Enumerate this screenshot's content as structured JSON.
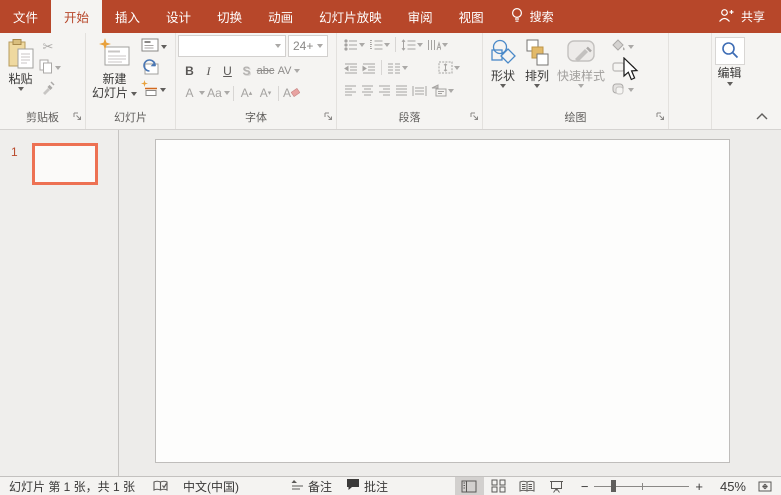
{
  "tabbar": {
    "tabs": [
      {
        "label": "文件"
      },
      {
        "label": "开始"
      },
      {
        "label": "插入"
      },
      {
        "label": "设计"
      },
      {
        "label": "切换"
      },
      {
        "label": "动画"
      },
      {
        "label": "幻灯片放映"
      },
      {
        "label": "审阅"
      },
      {
        "label": "视图"
      }
    ],
    "search_label": "搜索",
    "share_label": "共享"
  },
  "ribbon": {
    "clipboard": {
      "paste_label": "粘贴",
      "group_label": "剪贴板"
    },
    "slides": {
      "new_slide_line1": "新建",
      "new_slide_line2": "幻灯片",
      "group_label": "幻灯片"
    },
    "font": {
      "font_name_value": "",
      "font_size_value": "24+",
      "bold_label": "B",
      "italic_label": "I",
      "underline_label": "U",
      "shadow_label": "S",
      "strikethrough_label": "abc",
      "spacing_label": "AV",
      "font_color_label": "A",
      "change_case_label": "Aa",
      "grow_font_label": "A",
      "shrink_font_label": "A",
      "clear_format_label": "A",
      "group_label": "字体"
    },
    "paragraph": {
      "group_label": "段落"
    },
    "drawing": {
      "shapes_label": "形状",
      "arrange_label": "排列",
      "quick_styles_label": "快速样式",
      "group_label": "绘图"
    },
    "editing": {
      "editing_label": "编辑"
    }
  },
  "slides_panel": {
    "slide_number": "1"
  },
  "statusbar": {
    "slide_info": "幻灯片 第 1 张，共 1 张",
    "language": "中文(中国)",
    "notes_label": "备注",
    "comments_label": "批注",
    "zoom_out_label": "−",
    "zoom_in_label": "+",
    "zoom_level": "45%"
  },
  "colors": {
    "accent": "#B7472A",
    "selected_thumbnail_border": "#ED7153",
    "new_slide_sparkle": "#E9A13B"
  }
}
